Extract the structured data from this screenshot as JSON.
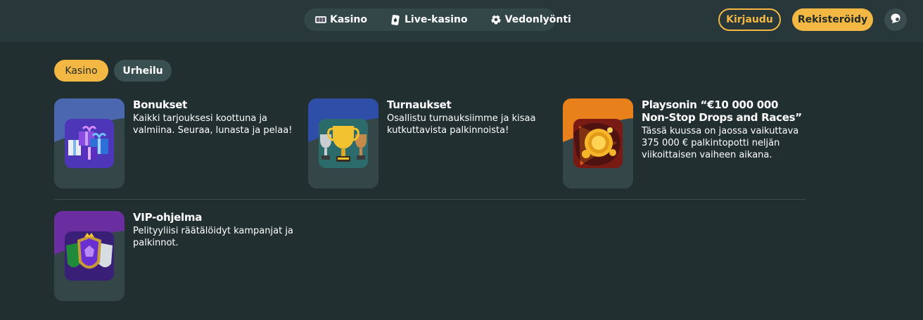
{
  "header": {
    "nav": [
      {
        "label": "Kasino",
        "icon": "slot-machine-icon"
      },
      {
        "label": "Live-kasino",
        "icon": "playing-card-icon"
      },
      {
        "label": "Vedonlyönti",
        "icon": "soccer-ball-icon"
      }
    ],
    "login_label": "Kirjaudu",
    "register_label": "Rekisteröidy",
    "chat_icon": "chat-bubble-icon"
  },
  "filters": [
    {
      "label": "Kasino",
      "active": true
    },
    {
      "label": "Urheilu",
      "active": false
    }
  ],
  "promotions": [
    {
      "title": "Bonukset",
      "description": "Kaikki tarjouksesi koottuna ja valmiina. Seuraa, lunasta ja pelaa!",
      "icon": "gift-boxes-icon"
    },
    {
      "title": "Turnaukset",
      "description": "Osallistu turnauksiimme ja kisaa kutkuttavista palkinnoista!",
      "icon": "trophies-icon"
    },
    {
      "title": "Playsonin “€10 000 000 Non-Stop Drops and Races”",
      "description": "Tässä kuussa on jaossa vaikuttava 375 000 € palkintopotti neljän viikoittaisen vaiheen aikana.",
      "icon": "gold-coin-icon"
    },
    {
      "title": "VIP-ohjelma",
      "description": "Pelityyliisi räätälöidyt kampanjat ja palkinnot.",
      "icon": "vip-shields-icon"
    }
  ],
  "colors": {
    "background": "#222f30",
    "header": "#283739",
    "accent": "#f3b844",
    "card": "#354648"
  }
}
